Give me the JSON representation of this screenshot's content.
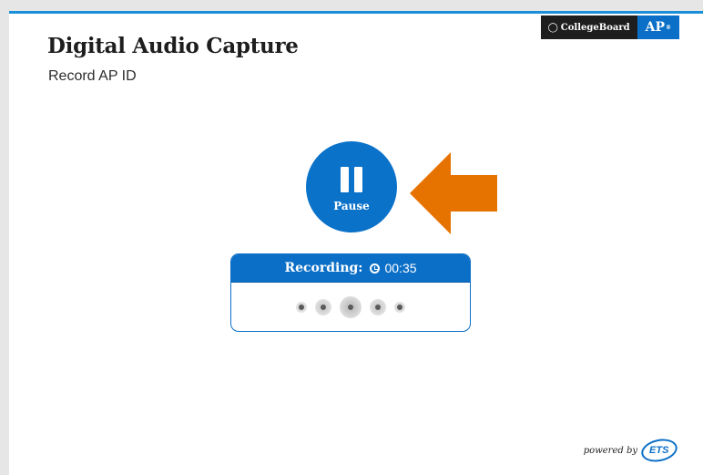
{
  "header": {
    "title": "Digital Audio Capture",
    "subtitle": "Record AP ID"
  },
  "brand": {
    "collegeboard": "CollegeBoard",
    "ap": "AP"
  },
  "pause_button": {
    "label": "Pause",
    "icon": "pause-icon"
  },
  "recording": {
    "label": "Recording:",
    "time": "00:35",
    "icon": "clock-icon"
  },
  "footer": {
    "powered_by": "powered by",
    "ets": "ETS"
  },
  "colors": {
    "accent": "#0b6fc7",
    "arrow": "#e67300",
    "top_border": "#1a8fd8"
  }
}
